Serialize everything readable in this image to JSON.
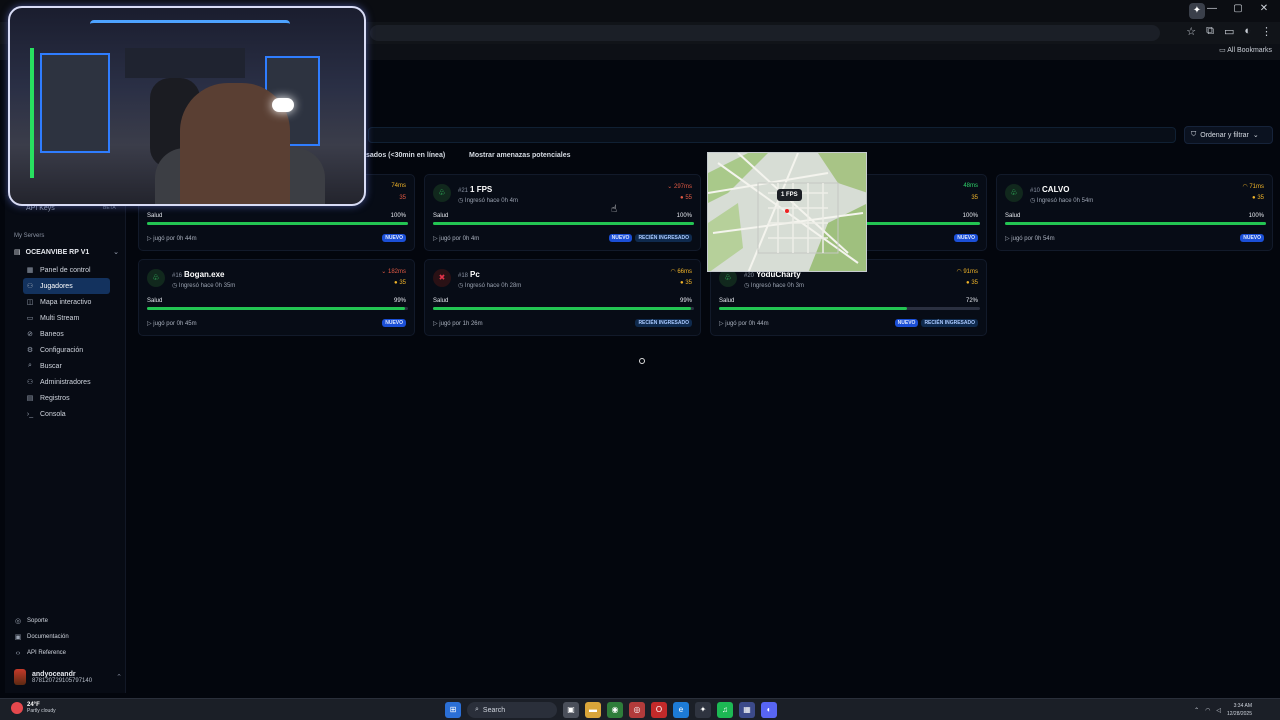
{
  "browser": {
    "bookmarks_label": "All Bookmarks",
    "window_controls": [
      "—",
      "▢",
      "✕"
    ]
  },
  "sidebar": {
    "api_keys_label": "API Keys",
    "api_keys_badge": "BETA",
    "section_title": "My Servers",
    "server_name": "OCEANVIBE RP V1",
    "nav": [
      {
        "label": "Panel de control",
        "icon": "grid-icon",
        "glyph": "▦"
      },
      {
        "label": "Jugadores",
        "icon": "users-icon",
        "glyph": "⚇",
        "active": true
      },
      {
        "label": "Mapa interactivo",
        "icon": "map-icon",
        "glyph": "◫"
      },
      {
        "label": "Multi Stream",
        "icon": "monitor-icon",
        "glyph": "▭"
      },
      {
        "label": "Baneos",
        "icon": "ban-icon",
        "glyph": "⊘"
      },
      {
        "label": "Configuración",
        "icon": "gear-icon",
        "glyph": "⚙"
      },
      {
        "label": "Buscar",
        "icon": "search-icon",
        "glyph": "⌕"
      },
      {
        "label": "Administradores",
        "icon": "admin-icon",
        "glyph": "⚇"
      },
      {
        "label": "Registros",
        "icon": "logs-icon",
        "glyph": "▤"
      },
      {
        "label": "Consola",
        "icon": "terminal-icon",
        "glyph": "›_"
      }
    ],
    "footer": [
      {
        "label": "Soporte",
        "icon": "support-icon",
        "glyph": "◎"
      },
      {
        "label": "Documentación",
        "icon": "book-icon",
        "glyph": "▣"
      },
      {
        "label": "API Reference",
        "icon": "code-icon",
        "glyph": "‹›"
      }
    ],
    "user": {
      "name": "andyoceandr",
      "id": "878120729105797140"
    }
  },
  "toolbar": {
    "sort_label": "Ordenar y filtrar",
    "filter_recent": "sados (<30min en línea)",
    "filter_threats": "Mostrar amenazas potenciales"
  },
  "players": [
    {
      "num": "#21",
      "name": "1 FPS",
      "joined": "Ingresó hace 0h 4m",
      "ping": "297ms",
      "ping_class": "bad",
      "pts": "55",
      "pts_class": "red",
      "health_label": "Salud",
      "health": "100%",
      "fill": 1.0,
      "played": "jugó por 0h 4m",
      "badges": [
        "NUEVO",
        "RECIÉN INGRESADO"
      ],
      "avatar": "red-less"
    },
    {
      "num": "#10",
      "name": "CALVO",
      "joined": "Ingresó hace 0h 54m",
      "ping": "71ms",
      "ping_class": "ok",
      "pts": "35",
      "pts_class": "",
      "health_label": "Salud",
      "health": "100%",
      "fill": 1.0,
      "played": "jugó por 0h 54m",
      "badges": [
        "NUEVO"
      ]
    },
    {
      "num": "#16",
      "name": "Bogan.exe",
      "joined": "Ingresó hace 0h 35m",
      "ping": "182ms",
      "ping_class": "bad",
      "pts": "35",
      "pts_class": "",
      "health_label": "Salud",
      "health": "99%",
      "fill": 0.99,
      "played": "jugó por 0h 45m",
      "badges": [
        "NUEVO"
      ]
    },
    {
      "num": "#18",
      "name": "Pc",
      "joined": "Ingresó hace 0h 28m",
      "ping": "66ms",
      "ping_class": "ok",
      "pts": "35",
      "pts_class": "",
      "health_label": "Salud",
      "health": "99%",
      "fill": 0.99,
      "played": "jugó por 1h 26m",
      "badges": [
        "RECIÉN INGRESADO"
      ]
    },
    {
      "num": "#20",
      "name": "YoduCharty",
      "joined": "Ingresó hace 0h 3m",
      "ping": "91ms",
      "ping_class": "ok",
      "pts": "35",
      "pts_class": "",
      "health_label": "Salud",
      "health": "72%",
      "fill": 0.72,
      "played": "jugó por 0h 44m",
      "badges": [
        "NUEVO",
        "RECIÉN INGRESADO"
      ]
    }
  ],
  "partial_cards": {
    "first": {
      "ping": "74ms",
      "pts": "35",
      "health": "100%",
      "played": "jugó por 0h 44m",
      "badge": "NUEVO"
    },
    "third": {
      "ping": "48ms",
      "pts": "35",
      "health": "100%",
      "badge": "NUEVO"
    }
  },
  "map_popup": {
    "tag": "1 FPS"
  },
  "taskbar": {
    "temp": "24°F",
    "weather": "Partly cloudy",
    "search": "Search",
    "time": "3:34 AM",
    "date": "12/28/2025"
  }
}
